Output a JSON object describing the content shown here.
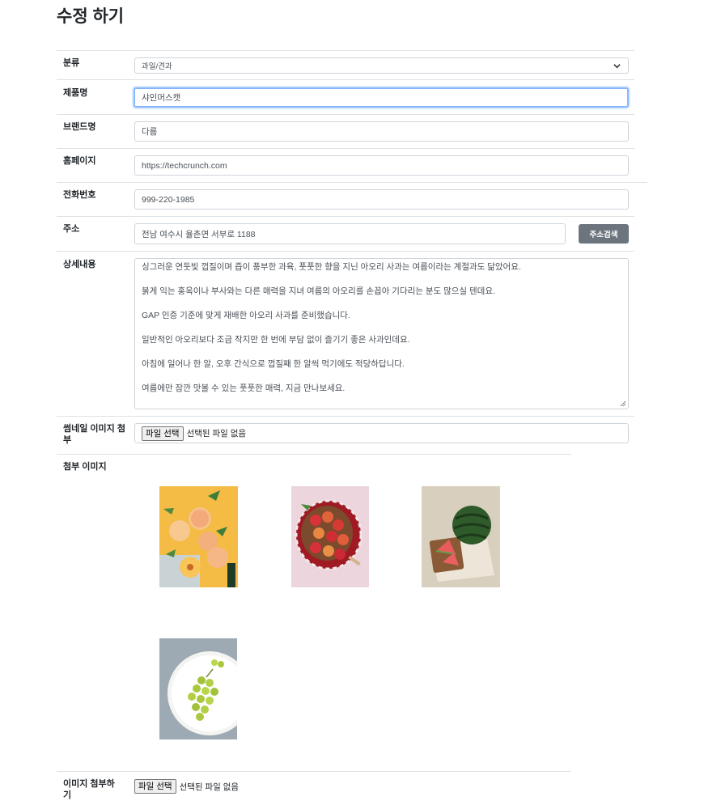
{
  "page": {
    "title": "수정 하기"
  },
  "form": {
    "category": {
      "label": "분류",
      "value": "과일/견과"
    },
    "product_name": {
      "label": "제품명",
      "value": "샤인머스캣"
    },
    "brand": {
      "label": "브랜드명",
      "value": "다름"
    },
    "homepage": {
      "label": "홈페이지",
      "value": "https://techcrunch.com"
    },
    "phone": {
      "label": "전화번호",
      "value": "999-220-1985"
    },
    "address": {
      "label": "주소",
      "value": "전남 여수시 율촌면 서부로 1188",
      "search_button": "주소검색"
    },
    "details": {
      "label": "상세내용",
      "lines": [
        "싱그러운 연둣빛 껍질이며 즙이 풍부한 과육, 풋풋한 향을 지닌 아오리 사과는 여름이라는 계절과도 닮았어요.",
        "붉게 익는 홍옥이나 부사와는 다른 매력을 지녀 여름의 아오리를 손꼽아 기다리는 분도 많으실 텐데요.",
        "GAP 인증 기준에 맞게 재배한 아오리 사과를 준비했습니다.",
        "일반적인 아오리보다 조금 작지만 한 번에 부담 없이 즐기기 좋은 사과인데요.",
        "아침에 일어나 한 알, 오후 간식으로 껍질째 한 알씩 먹기에도 적당하답니다.",
        "여름에만 잠깐 맛볼 수 있는 풋풋한 매력, 지금 만나보세요."
      ]
    },
    "thumbnail": {
      "label": "썸네일 이미지 첨부",
      "button": "파일 선택",
      "status": "선택된 파일 없음"
    },
    "attached_images": {
      "label": "첨부 이미지"
    },
    "attach": {
      "label": "이미지 첨부하기",
      "button": "파일 선택",
      "status": "선택된 파일 없음"
    }
  },
  "images": [
    {
      "icon": "peach-photo"
    },
    {
      "icon": "apples-basket-photo"
    },
    {
      "icon": "watermelon-photo"
    },
    {
      "icon": "green-grapes-photo"
    }
  ],
  "colors": {
    "focus": "#86b7fe",
    "button_gray": "#6c757d",
    "border": "#ced4da"
  }
}
